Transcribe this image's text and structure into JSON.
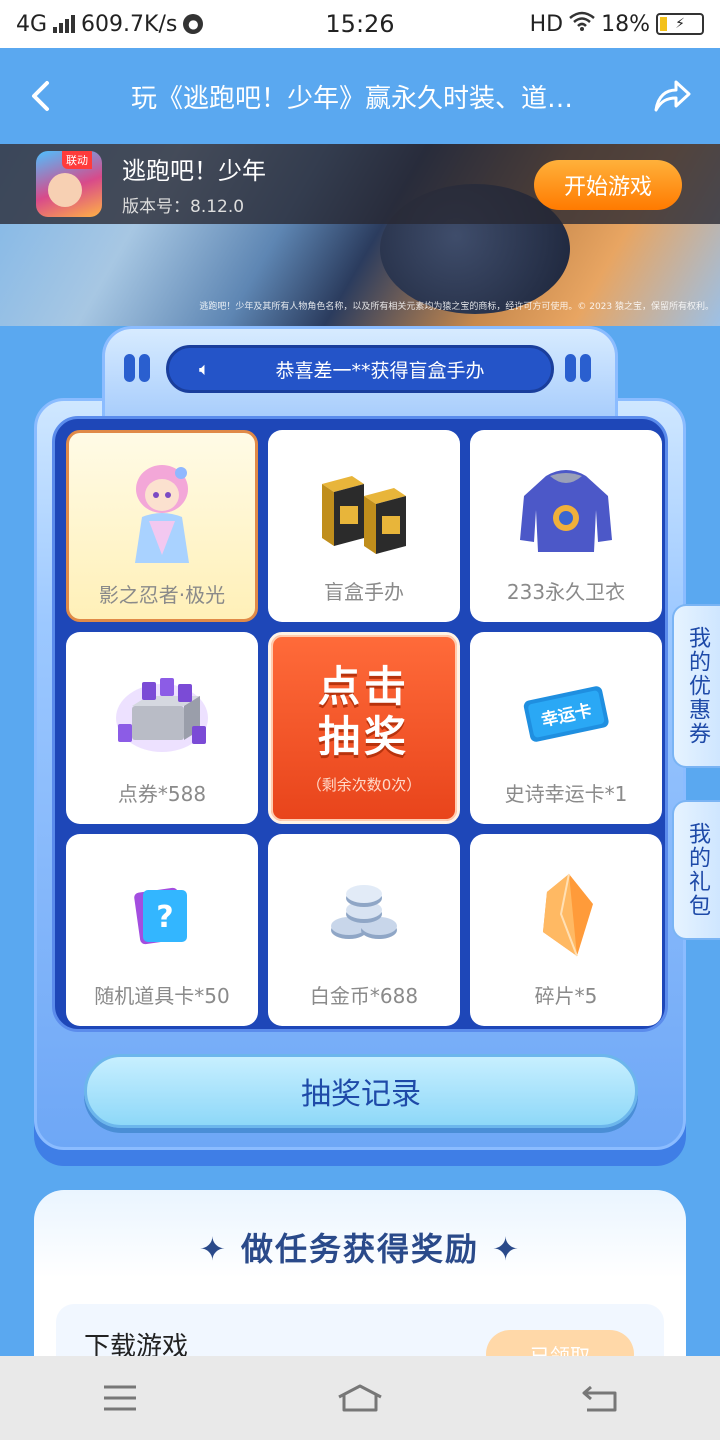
{
  "status_bar": {
    "network": "4G",
    "speed": "609.7K/s",
    "time": "15:26",
    "hd": "HD",
    "battery": "18%"
  },
  "header": {
    "title": "玩《逃跑吧！少年》赢永久时装、道…"
  },
  "game": {
    "icon_tag": "联动",
    "name": "逃跑吧！少年",
    "version": "版本号：8.12.0",
    "start_label": "开始游戏",
    "copyright": "逃跑吧！少年及其所有人物角色名称，以及所有相关元素均为猿之宝的商标，经许可方可使用。© 2023 猿之宝，保留所有权利。"
  },
  "lottery": {
    "ticker_text": "恭喜差一**获得盲盒手办",
    "prizes": [
      {
        "label": "影之忍者·极光",
        "icon": "character-icon"
      },
      {
        "label": "盲盒手办",
        "icon": "blind-box-icon"
      },
      {
        "label": "233永久卫衣",
        "icon": "hoodie-icon"
      },
      {
        "label": "点券*588",
        "icon": "coupon-box-icon"
      },
      {
        "label": "史诗幸运卡*1",
        "icon": "lucky-card-icon",
        "card_text": "幸运卡"
      },
      {
        "label": "随机道具卡*50",
        "icon": "item-card-icon"
      },
      {
        "label": "白金币*688",
        "icon": "platinum-coin-icon"
      },
      {
        "label": "碎片*5",
        "icon": "shard-icon"
      }
    ],
    "draw_line1": "点击",
    "draw_line2": "抽奖",
    "draw_remaining": "（剩余次数0次）",
    "record_label": "抽奖记录"
  },
  "side_tabs": {
    "coupons": "我的优惠券",
    "gifts": "我的礼包"
  },
  "tasks": {
    "title": "✦ 做任务获得奖励 ✦",
    "items": [
      {
        "name": "下载游戏",
        "status": "已领取"
      }
    ]
  },
  "colors": {
    "page_bg": "#5aa8f0",
    "accent_orange": "#ff7a00",
    "grid_blue": "#1e47b8"
  }
}
